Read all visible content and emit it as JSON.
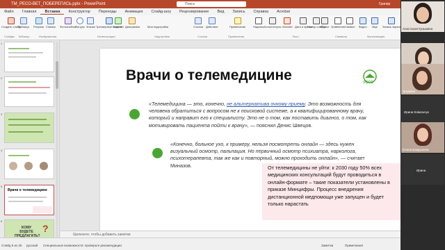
{
  "titlebar": {
    "title": "TM_РЕСО-ВЕТ_ПОБЕРЕГИСЬ.pptx - PowerPoint",
    "search_placeholder": "Поиск",
    "user": "Гриняр"
  },
  "tabs": [
    "Файл",
    "Главная",
    "Вставка",
    "Конструктор",
    "Переходы",
    "Анимация",
    "Слайд-шоу",
    "Рецензирование",
    "Вид",
    "Запись",
    "Справка",
    "Acrobat"
  ],
  "active_tab": "Вставка",
  "ribbon": {
    "buttons": [
      "Создать слайд",
      "Таблица",
      "Рисунки",
      "Снимок",
      "Фотоальбом",
      "Фигуры",
      "Значки",
      "Трехмерные модели",
      "SmartArt",
      "Диаграмма",
      "Мои надстройки",
      "Ссылка",
      "Действие",
      "Примечание",
      "Надпись",
      "Колонтитулы",
      "WordArt",
      "Дата и время",
      "Номер слайда",
      "Объект",
      "Уравнение",
      "Символ",
      "Видео",
      "Звук",
      "Запись экрана"
    ],
    "groups": [
      "Слайды",
      "Таблицы",
      "Изображения",
      "Иллюстрации",
      "Надстройки",
      "Ссылки",
      "Примечания",
      "Текст",
      "Символы",
      "Мультимедиа"
    ]
  },
  "thumbnails": [
    {
      "num": "1"
    },
    {
      "num": "2"
    },
    {
      "num": "3"
    },
    {
      "num": "4"
    },
    {
      "num": "5",
      "label": "Врачи о телемедицине"
    },
    {
      "num": "6",
      "label": "КОМУ БУДЕТЕ ПРЕДЛАГАТЬ?"
    }
  ],
  "slide": {
    "title": "Врачи о телемедицине",
    "logo_text": "РЕСО",
    "quote1_pre": "«Телемедицина — это, конечно, ",
    "quote1_link": "не альтернатива очному приему",
    "quote1_post": ". Это возможность для человека обратиться с вопросом не к поисковой системе, а к квалифицированному врачу, который и направит его к специалисту. Это не о том, как поставить диагноз, о том, как мотивировать пациента пойти к врачу»,",
    "quote1_author": " — пояснил Денис Швецов.",
    "quote2": "«Конечно, больное ухо, к примеру, нельзя посмотреть онлайн — здесь нужен визуальный осмотр, пальпация. Но первичный осмотр психиатра, нарколога, психотерапевта, так же как и повторный, можно проходить онлайн»,",
    "quote2_author": " — считает Миназов.",
    "infobox": "От телемедицины не уйти: к 2030 году 50% всех медицинских консультаций будут проводиться в онлайн-формате – такие показатели установлены в приказе Минцифры. Процесс внедрения дистанционной медпомощи уже запущен и будет только нарастать"
  },
  "notes_placeholder": "Щелкните, чтобы добавить заметки",
  "status": {
    "slide_info": "Слайд 5 из 25",
    "language": "русский",
    "accessibility": "Специальные возможности: проверьте рекомендации",
    "notes": "Заметки",
    "comments": "Примечания"
  },
  "participants": [
    {
      "name": "Анастасия Кузьмина"
    },
    {
      "name": "Инна Суворова"
    },
    {
      "name": "Эльвина"
    },
    {
      "name": "Ирина Ковальчук"
    },
    {
      "name": "Елена Бакрушина"
    },
    {
      "name": "Ирина"
    }
  ],
  "colors": {
    "accent": "#b7472a",
    "green_dot": "#4aa633",
    "infobox_bg": "#fde9ec"
  }
}
